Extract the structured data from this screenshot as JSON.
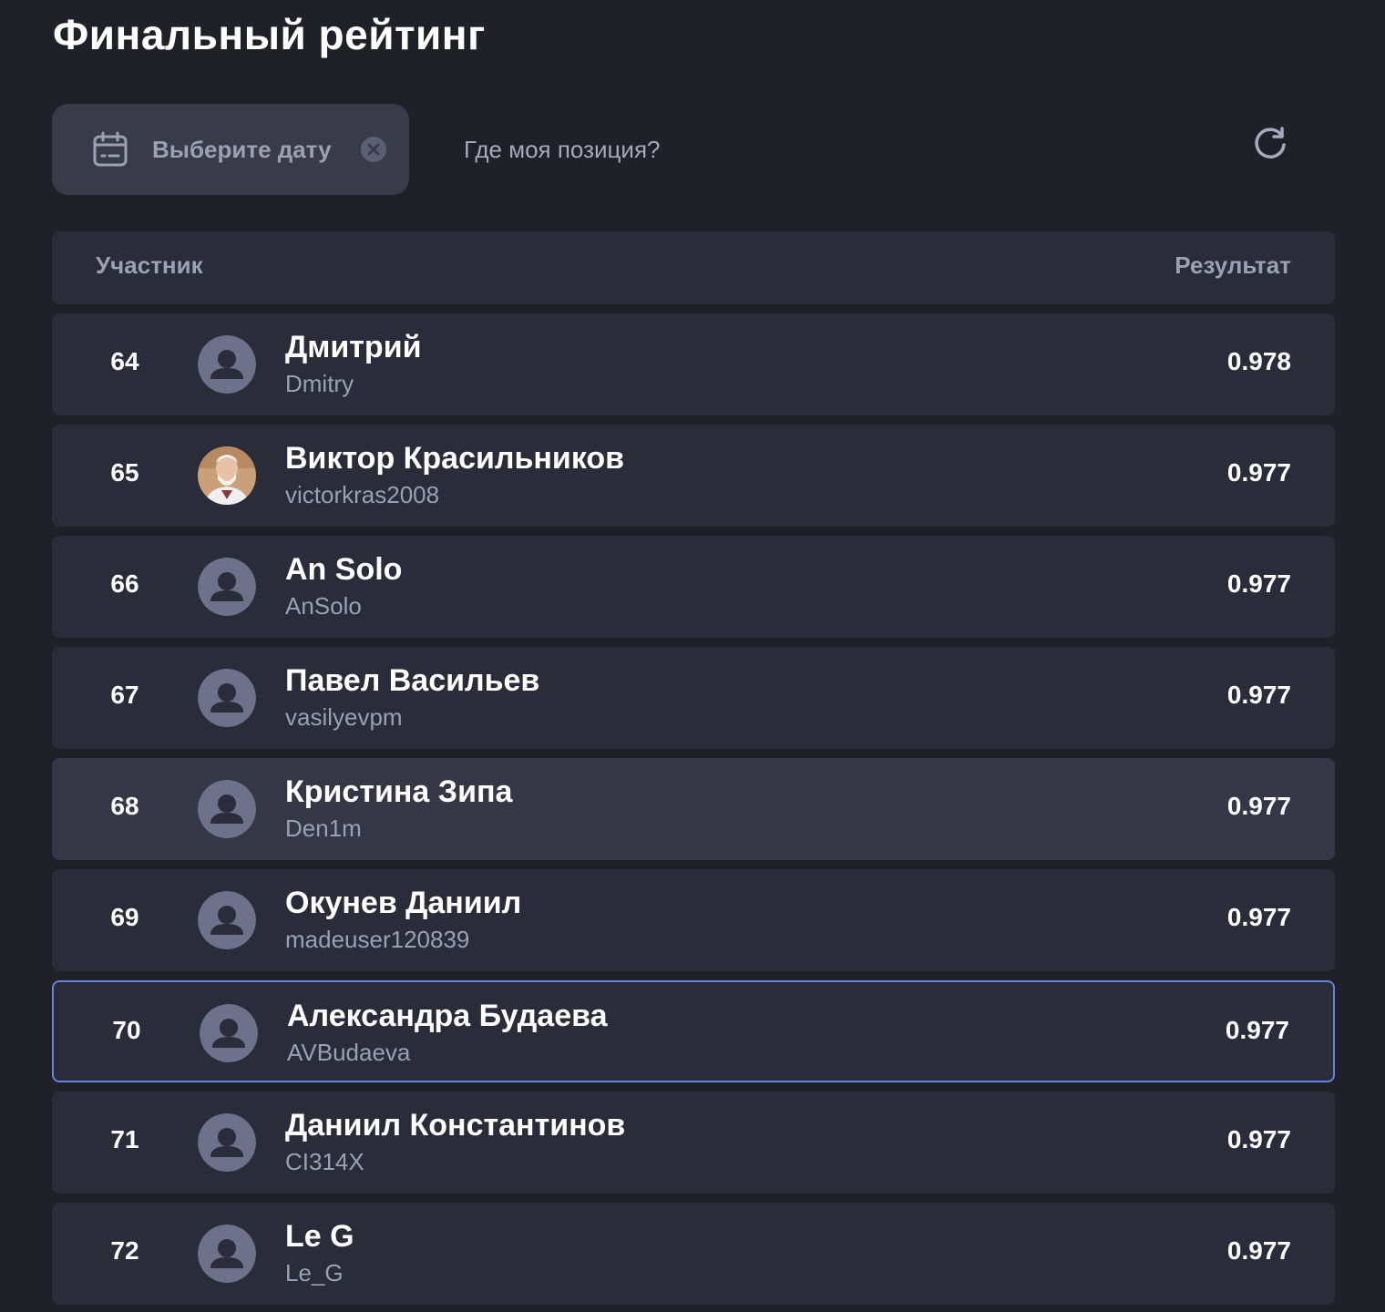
{
  "page": {
    "title": "Финальный рейтинг"
  },
  "toolbar": {
    "date_placeholder": "Выберите дату",
    "where_label": "Где моя позиция?",
    "icons": [
      "calendar-icon",
      "clear-icon",
      "refresh-icon"
    ]
  },
  "table": {
    "col_participant": "Участник",
    "col_result": "Результат",
    "rows": [
      {
        "rank": "64",
        "name": "Дмитрий",
        "login": "Dmitry",
        "score": "0.978",
        "avatar": "default"
      },
      {
        "rank": "65",
        "name": "Виктор Красильников",
        "login": "victorkras2008",
        "score": "0.977",
        "avatar": "photo"
      },
      {
        "rank": "66",
        "name": "An Solo",
        "login": "AnSolo",
        "score": "0.977",
        "avatar": "default"
      },
      {
        "rank": "67",
        "name": "Павел Васильев",
        "login": "vasilyevpm",
        "score": "0.977",
        "avatar": "default"
      },
      {
        "rank": "68",
        "name": "Кристина Зипа",
        "login": "Den1m",
        "score": "0.977",
        "avatar": "default"
      },
      {
        "rank": "69",
        "name": "Окунев Даниил",
        "login": "madeuser120839",
        "score": "0.977",
        "avatar": "default"
      },
      {
        "rank": "70",
        "name": "Александра Будаева",
        "login": "AVBudaeva",
        "score": "0.977",
        "avatar": "default"
      },
      {
        "rank": "71",
        "name": "Даниил Константинов",
        "login": "CI314X",
        "score": "0.977",
        "avatar": "default"
      },
      {
        "rank": "72",
        "name": "Le G",
        "login": "Le_G",
        "score": "0.977",
        "avatar": "default"
      }
    ]
  },
  "colors": {
    "background": "#1f2028",
    "row_background": "#2a2c39",
    "row_hover": "#353747",
    "selected_border": "#6b7fdc",
    "muted_text": "#9d9fb5",
    "avatar_bg": "#6f7089"
  }
}
